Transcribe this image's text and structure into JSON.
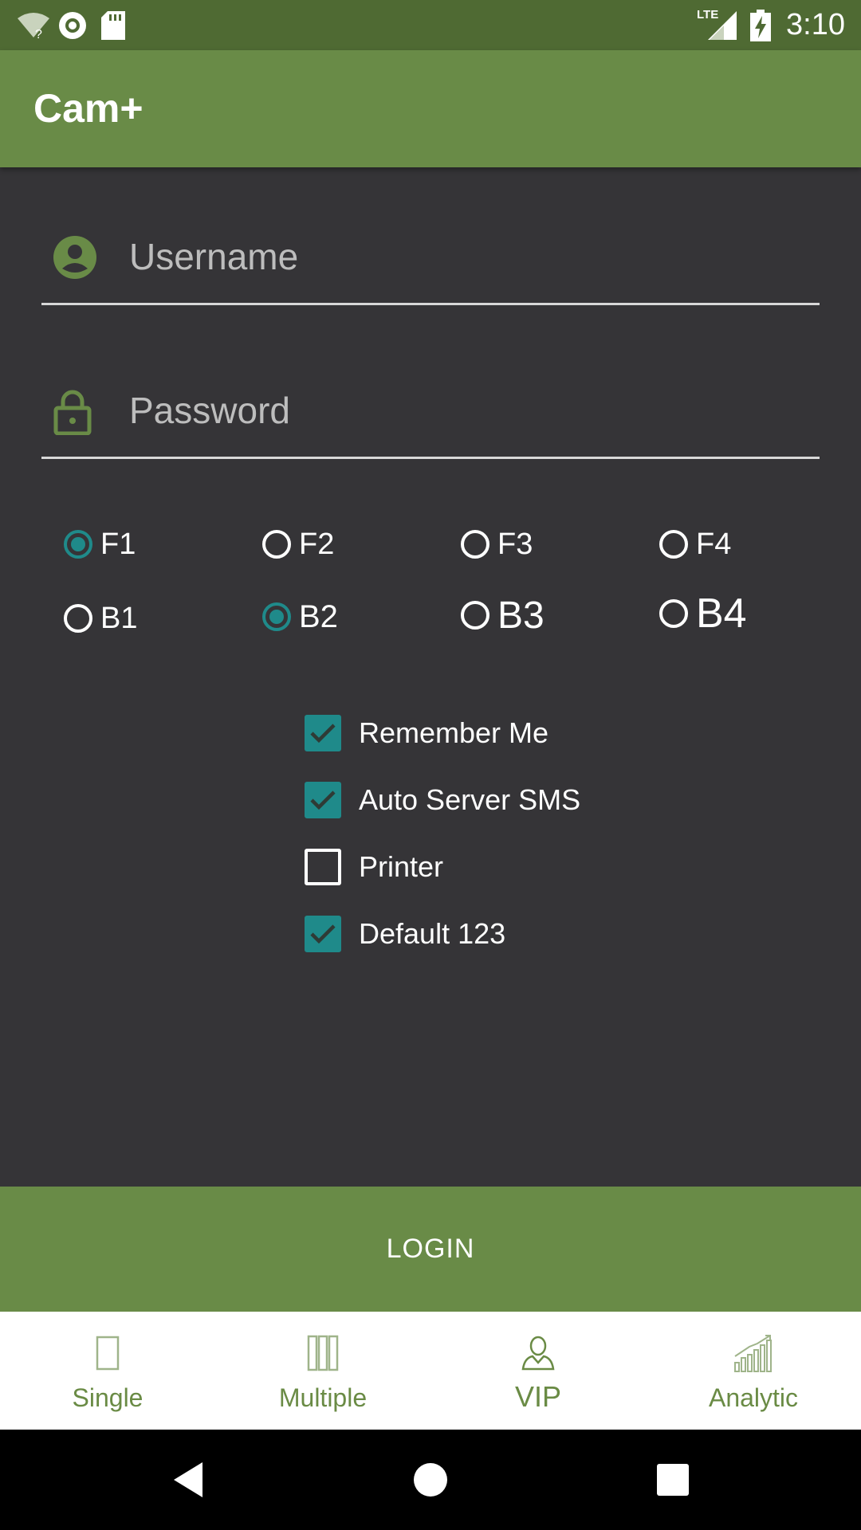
{
  "status_bar": {
    "time": "3:10",
    "network_label": "LTE",
    "icons": [
      "wifi-unknown-icon",
      "sync-circle-icon",
      "sd-card-icon",
      "cellular-signal-icon",
      "battery-charging-icon"
    ]
  },
  "app_bar": {
    "title": "Cam+"
  },
  "form": {
    "username_placeholder": "Username",
    "password_placeholder": "Password",
    "username_value": "",
    "password_value": ""
  },
  "radios": [
    {
      "label": "F1",
      "checked": true
    },
    {
      "label": "F2",
      "checked": false
    },
    {
      "label": "F3",
      "checked": false
    },
    {
      "label": "F4",
      "checked": false
    },
    {
      "label": "B1",
      "checked": false
    },
    {
      "label": "B2",
      "checked": true
    },
    {
      "label": "B3",
      "checked": false
    },
    {
      "label": "B4",
      "checked": false
    }
  ],
  "checkboxes": [
    {
      "label": "Remember Me",
      "checked": true
    },
    {
      "label": "Auto Server SMS",
      "checked": true
    },
    {
      "label": "Printer",
      "checked": false
    },
    {
      "label": "Default 123",
      "checked": true
    }
  ],
  "login_label": "LOGIN",
  "tabs": [
    {
      "label": "Single",
      "icon": "single-frame-icon"
    },
    {
      "label": "Multiple",
      "icon": "multiple-frames-icon"
    },
    {
      "label": "VIP",
      "icon": "vip-person-icon"
    },
    {
      "label": "Analytic",
      "icon": "analytic-chart-icon"
    }
  ],
  "colors": {
    "status_bar": "#4f6a33",
    "primary": "#698b47",
    "background": "#353437",
    "accent": "#1f8a8a",
    "tab_text": "#6a8b45"
  }
}
